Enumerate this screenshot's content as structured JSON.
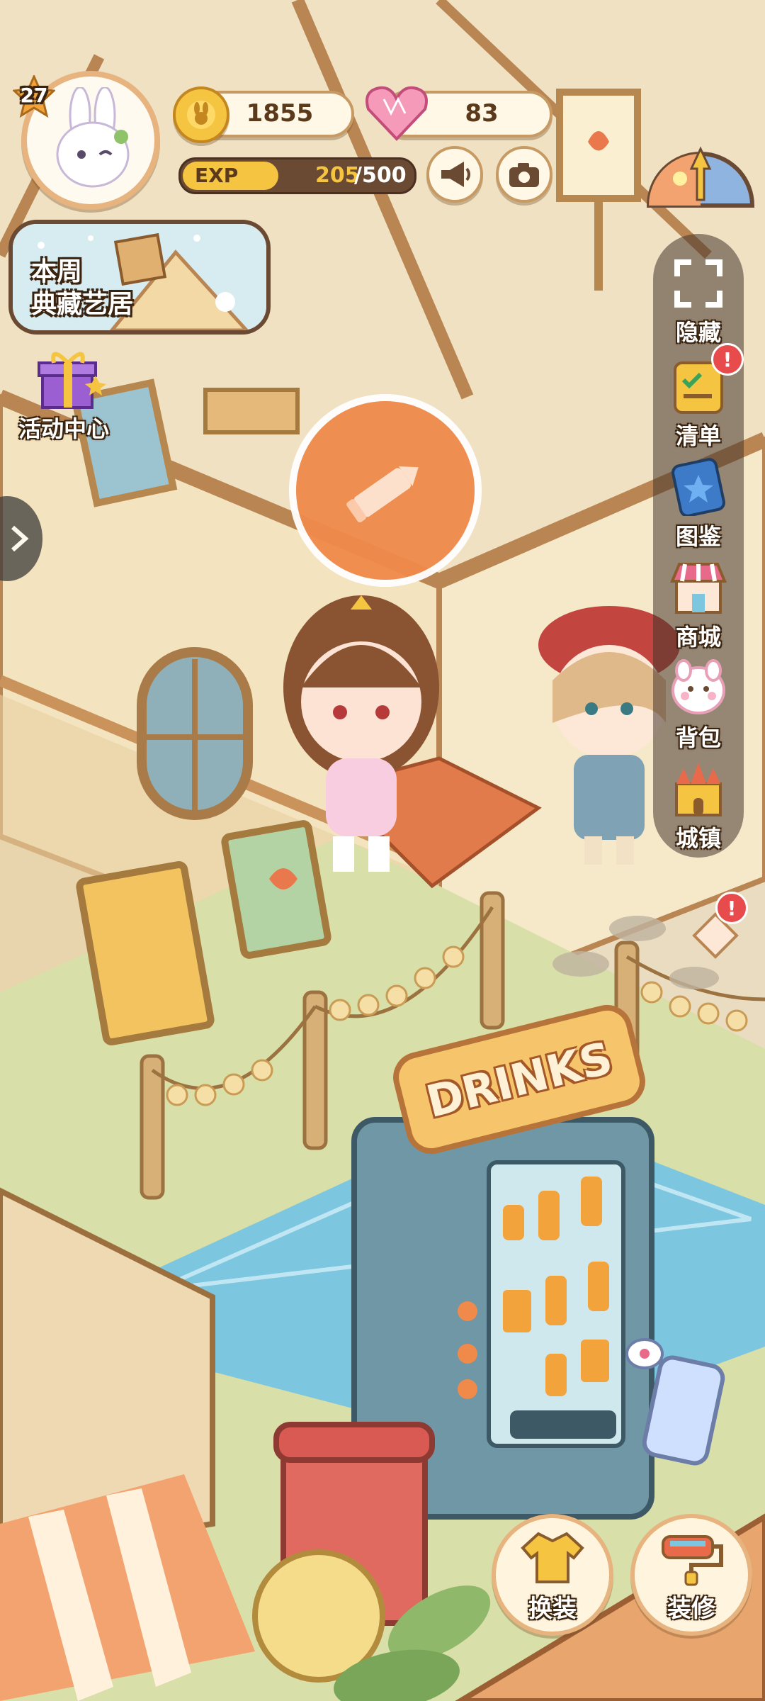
{
  "player": {
    "level": "27",
    "avatar": "bunny-avatar"
  },
  "currency": {
    "coins": "1855",
    "hearts": "83"
  },
  "exp": {
    "label": "EXP",
    "current": "205",
    "max": "/500",
    "progress": 0.41
  },
  "weekly_banner": {
    "line1": "本周",
    "line2": "典藏艺居"
  },
  "event_center": {
    "label": "活动中心"
  },
  "right_menu": {
    "items": [
      {
        "label": "隐藏",
        "icon": "hide-frame-icon"
      },
      {
        "label": "清单",
        "icon": "checklist-icon"
      },
      {
        "label": "图鉴",
        "icon": "collection-book-icon"
      },
      {
        "label": "商城",
        "icon": "shop-icon"
      },
      {
        "label": "背包",
        "icon": "backpack-icon"
      },
      {
        "label": "城镇",
        "icon": "castle-icon"
      }
    ]
  },
  "badge": {
    "alert": "!"
  },
  "scene": {
    "vending_sign": "DRINKS"
  },
  "bottom_buttons": {
    "outfit": "换装",
    "decorate": "装修"
  },
  "colors": {
    "accent_orange": "#f08a4b",
    "wood": "#c89a63",
    "panel_bg": "#fff8e6",
    "exp_bar": "#f5c542",
    "badge_red": "#e84b4b",
    "water": "#7cc6df",
    "grass": "#d9dfa8"
  }
}
